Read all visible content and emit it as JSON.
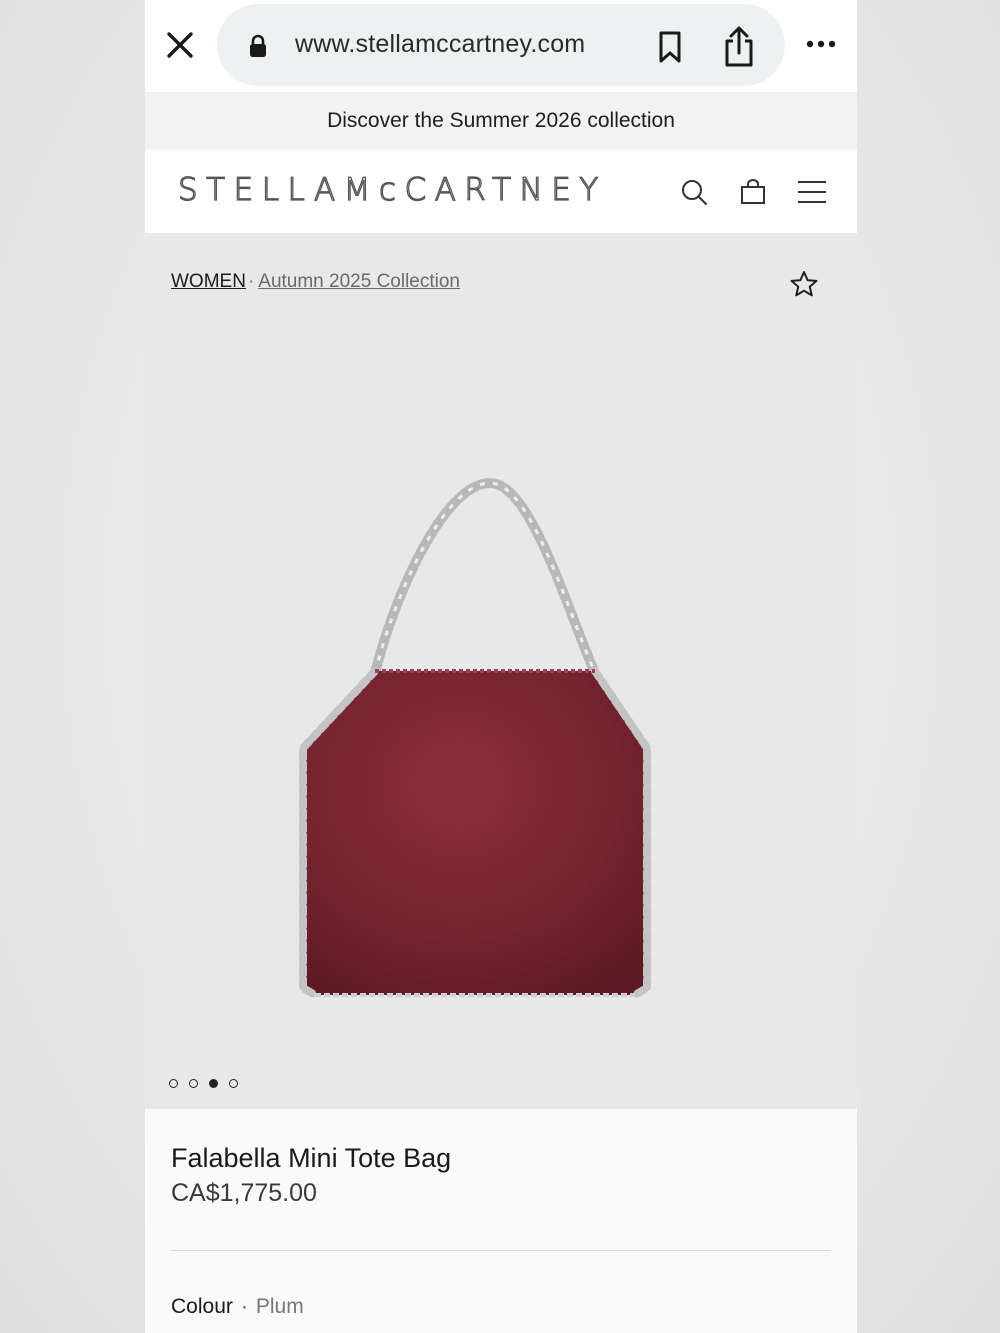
{
  "browser": {
    "url": "www.stellamccartney.com",
    "icons": [
      "close-icon",
      "lock-icon",
      "bookmark-icon",
      "share-icon",
      "more-icon"
    ]
  },
  "promo": {
    "text": "Discover the Summer 2026 collection"
  },
  "header": {
    "logo_text": "STELLAMcCARTNEY",
    "icons": [
      "search-icon",
      "shopping-bag-icon",
      "menu-icon"
    ]
  },
  "gallery": {
    "breadcrumb": {
      "women": "WOMEN",
      "separator": "·",
      "collection": "Autumn 2025 Collection"
    },
    "image_count": 4,
    "active_image_index": 2,
    "bag_color": "#7a2530"
  },
  "product": {
    "name": "Falabella Mini Tote Bag",
    "price": "CA$1,775.00",
    "colour_label": "Colour",
    "colour_separator": "·",
    "colour_value": "Plum"
  }
}
